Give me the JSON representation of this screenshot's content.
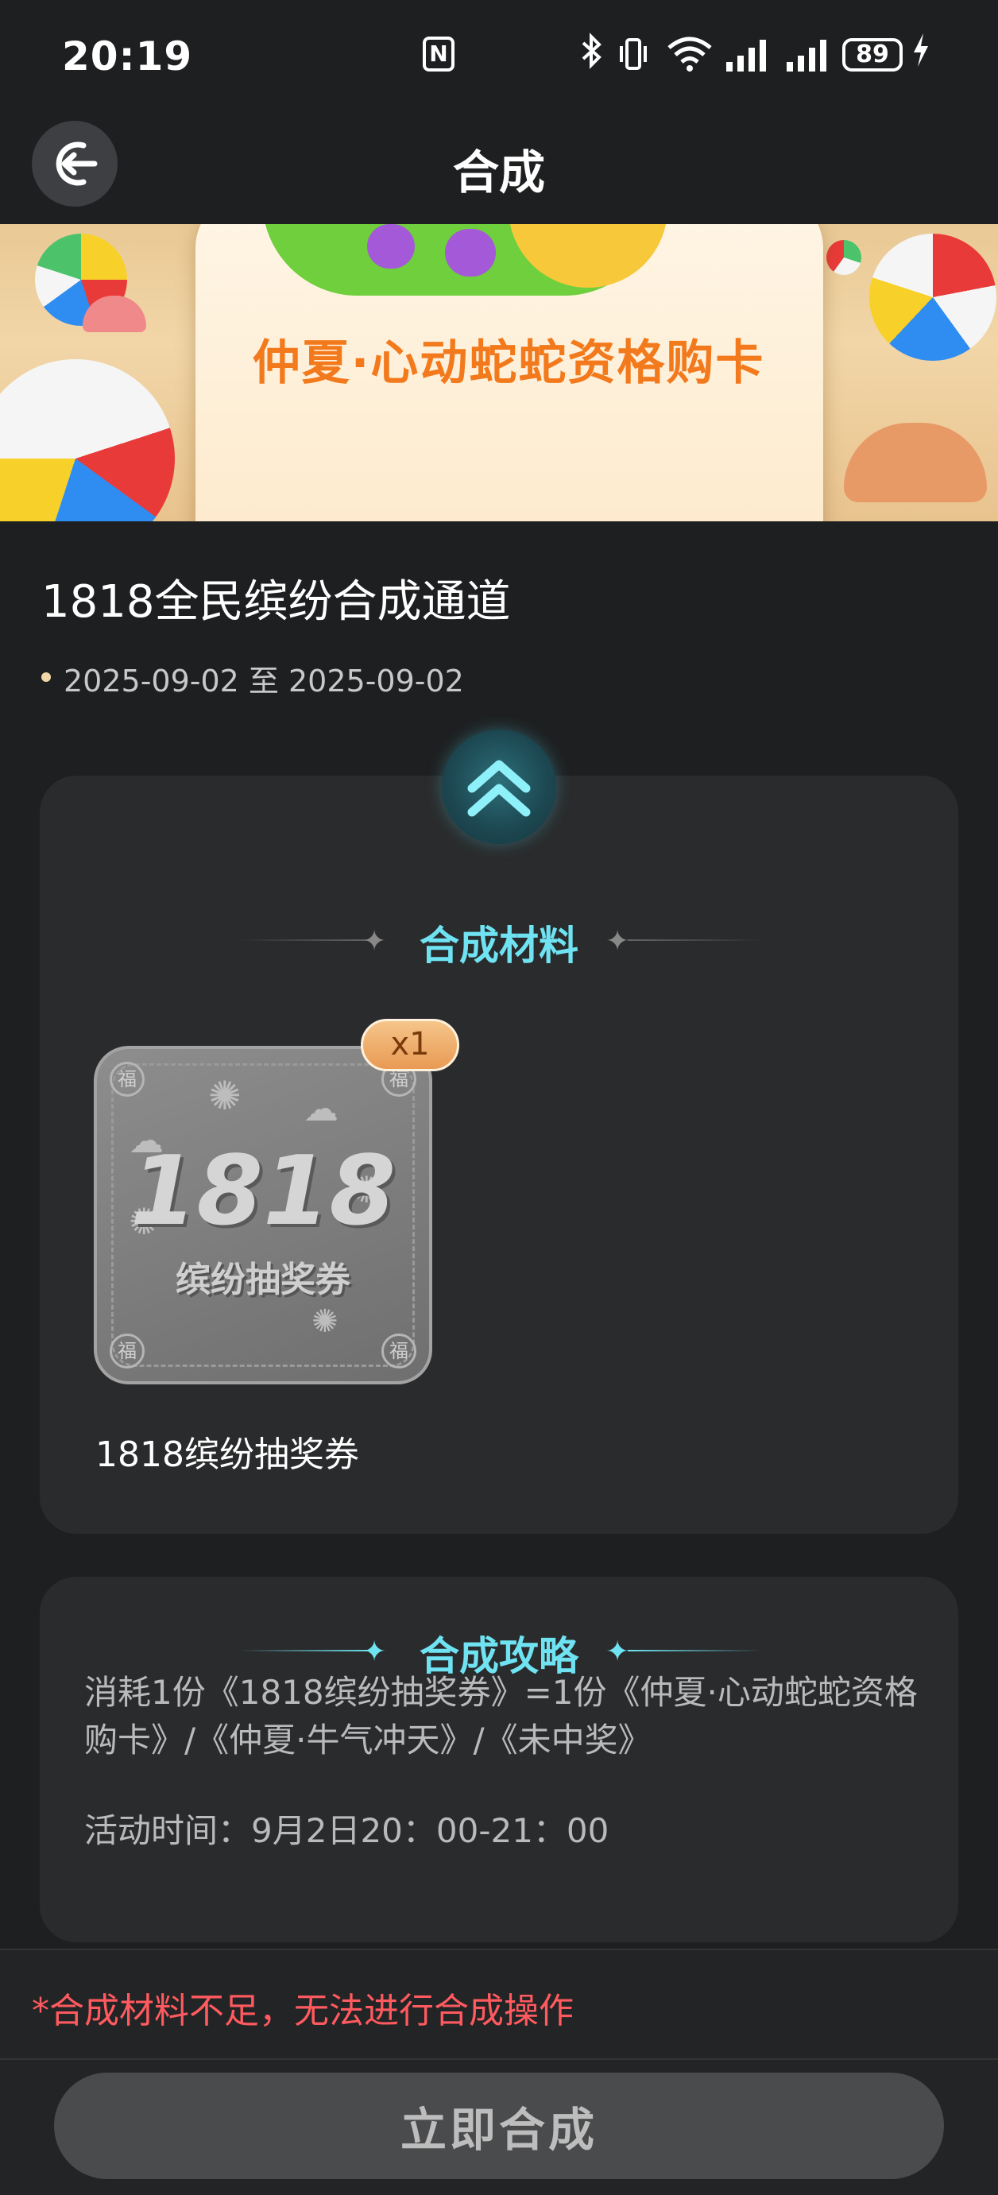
{
  "status_bar": {
    "time": "20:19",
    "battery": "89",
    "nfc_label": "N",
    "icons": [
      "nfc-icon",
      "bluetooth-icon",
      "vibrate-icon",
      "wifi-icon",
      "signal-icon",
      "signal-icon",
      "battery-icon",
      "charging-icon"
    ]
  },
  "header": {
    "title": "合成",
    "back_icon": "back-arrow-icon"
  },
  "banner": {
    "text": "仲夏·心动蛇蛇资格购卡"
  },
  "activity": {
    "title": "1818全民缤纷合成通道",
    "date_range": "2025-09-02 至 2025-09-02"
  },
  "materials": {
    "section_title": "合成材料",
    "items": [
      {
        "name": "1818缤纷抽奖券",
        "quantity": "x1",
        "art_number": "1818",
        "art_label": "缤纷抽奖券",
        "corner_char": "福"
      }
    ]
  },
  "strategy": {
    "section_title": "合成攻略",
    "description": "消耗1份《1818缤纷抽奖券》=1份《仲夏·心动蛇蛇资格购卡》/《仲夏·牛气冲天》/《未中奖》",
    "activity_time": "活动时间：9月2日20：00-21：00"
  },
  "footer": {
    "warning": "*合成材料不足，无法进行合成操作",
    "submit_label": "立即合成"
  },
  "colors": {
    "background": "#1e1f20",
    "card": "#2a2b2c",
    "accent_cyan": "#6fe3f2",
    "warning_red": "#ff5a5f",
    "banner_orange": "#f27a1d",
    "badge_orange": "#e89a54"
  }
}
